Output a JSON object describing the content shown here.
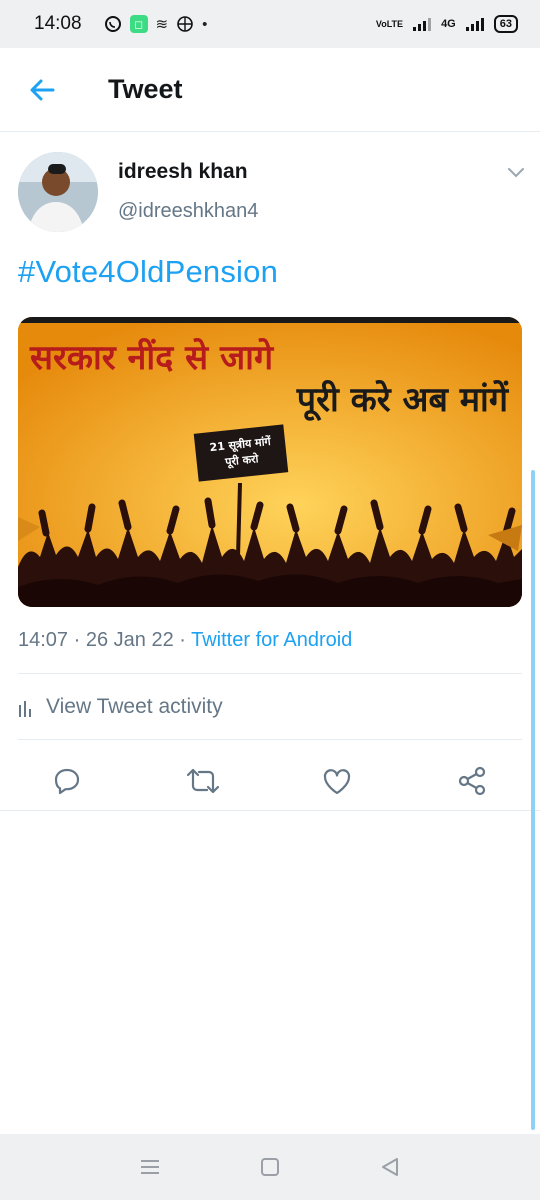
{
  "status_bar": {
    "time": "14:08",
    "network": "VoLTE",
    "network_type": "4G",
    "battery": "63"
  },
  "header": {
    "title": "Tweet"
  },
  "tweet": {
    "author_name": "idreesh khan",
    "author_handle": "@idreeshkhan4",
    "text": "#Vote4OldPension",
    "media": {
      "line1": "सरकार नींद से जागे",
      "line2": "पूरी करे अब मांगें",
      "placard_line1": "21 सूत्रीय मांगें",
      "placard_line2": "पूरी करो"
    },
    "time": "14:07",
    "date": "26 Jan 22",
    "separator": " · ",
    "source": "Twitter for Android",
    "activity_label": "View Tweet activity"
  },
  "colors": {
    "accent": "#1da1f2",
    "secondary_text": "#657786",
    "poster_orange": "#f2a51c",
    "poster_red": "#b71c1c"
  }
}
